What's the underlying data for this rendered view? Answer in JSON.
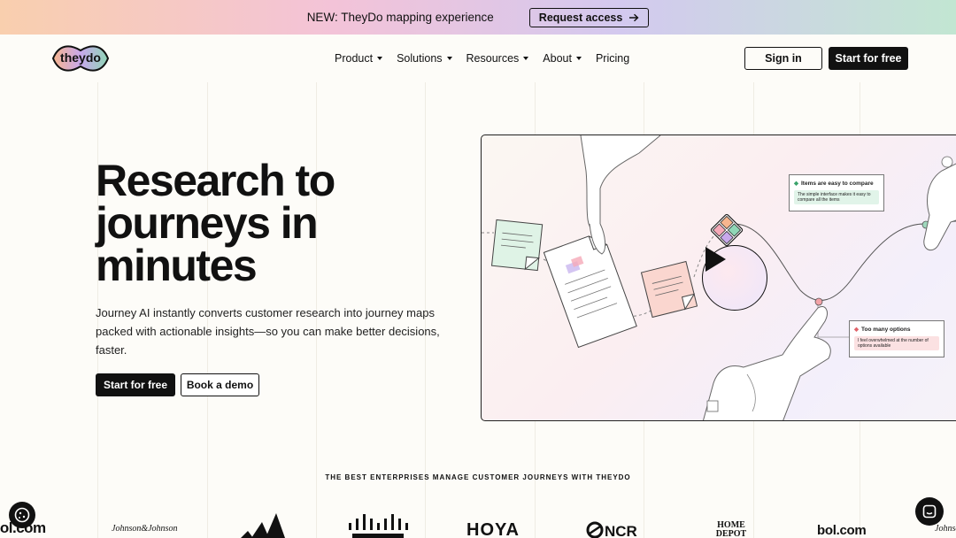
{
  "announcement": {
    "text": "NEW: TheyDo mapping experience",
    "button_label": "Request access"
  },
  "nav": {
    "logo_text": "theydo",
    "items": [
      {
        "label": "Product",
        "has_dropdown": true
      },
      {
        "label": "Solutions",
        "has_dropdown": true
      },
      {
        "label": "Resources",
        "has_dropdown": true
      },
      {
        "label": "About",
        "has_dropdown": true
      },
      {
        "label": "Pricing",
        "has_dropdown": false
      }
    ],
    "sign_in": "Sign in",
    "start_free": "Start for free"
  },
  "hero": {
    "title": "Research to journeys in minutes",
    "description": "Journey AI instantly converts customer research into journey maps packed with actionable insights—so you can make better decisions, faster.",
    "cta_primary": "Start for free",
    "cta_secondary": "Book a demo"
  },
  "video": {
    "card_compare_title": "Items are easy to compare",
    "card_compare_body": "The simple interface makes it easy to compare all the items",
    "card_options_title": "Too many options",
    "card_options_body": "I feel overwhelmed at the number of options available"
  },
  "enterprise_heading": "THE BEST ENTERPRISES MANAGE CUSTOMER JOURNEYS WITH THEYDO",
  "brand_logos": [
    "bol.com",
    "Johnson&Johnson",
    "adidas",
    "cisco",
    "HOYA",
    "NCR",
    "HOME DEPOT",
    "bol.com",
    "Johnson&Johnson"
  ],
  "colors": {
    "accent_dark": "#111111",
    "background": "#fdfcf8",
    "logo_gradient": [
      "#f7b58e",
      "#c8a8ec",
      "#8fd6b6"
    ]
  },
  "icons": {
    "arrow": "arrow-right-icon",
    "play": "play-icon",
    "cookie": "cookie-icon",
    "chat": "chat-icon"
  }
}
